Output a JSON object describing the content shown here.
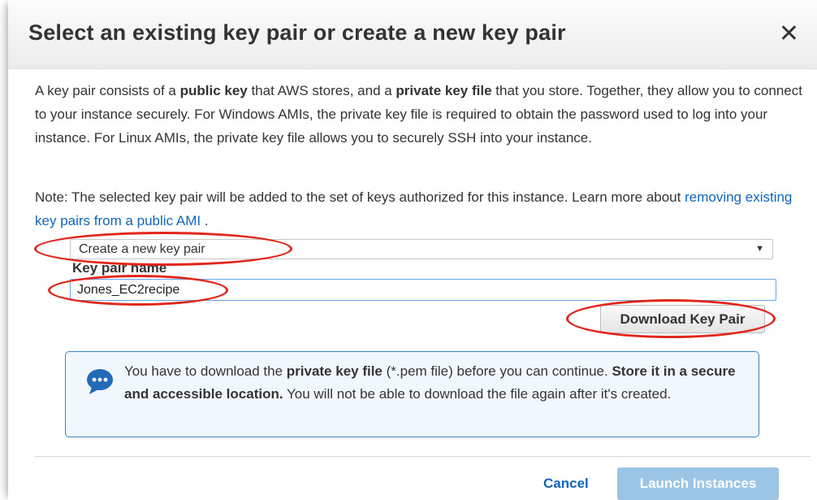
{
  "dialog": {
    "title": "Select an existing key pair or create a new key pair",
    "close_icon": "close-icon"
  },
  "intro": {
    "t1": "A key pair consists of a ",
    "b1": "public key",
    "t2": " that AWS stores, and a ",
    "b2": "private key file",
    "t3": " that you store. Together, they allow you to connect to your instance securely. For Windows AMIs, the private key file is required to obtain the password used to log into your instance. For Linux AMIs, the private key file allows you to securely SSH into your instance."
  },
  "note": {
    "prefix": "Note: The selected key pair will be added to the set of keys authorized for this instance. Learn more about ",
    "link": "removing existing key pairs from a public AMI",
    "suffix": " ."
  },
  "key_pair_select": {
    "selected": "Create a new key pair",
    "arrow_icon": "dropdown-arrow-icon"
  },
  "key_pair_name": {
    "label": "Key pair name",
    "value": "Jones_EC2recipe"
  },
  "download_button": {
    "label": "Download Key Pair"
  },
  "info": {
    "icon": "speech-bubble-icon",
    "t1": "You have to download the ",
    "b1": "private key file",
    "t2": " (*.pem file) before you can continue. ",
    "b2": "Store it in a secure and accessible location.",
    "t3": " You will not be able to download the file again after it's created."
  },
  "footer": {
    "cancel_label": "Cancel",
    "launch_label": "Launch Instances"
  },
  "annotations": {
    "oval_color": "#e1251b"
  }
}
